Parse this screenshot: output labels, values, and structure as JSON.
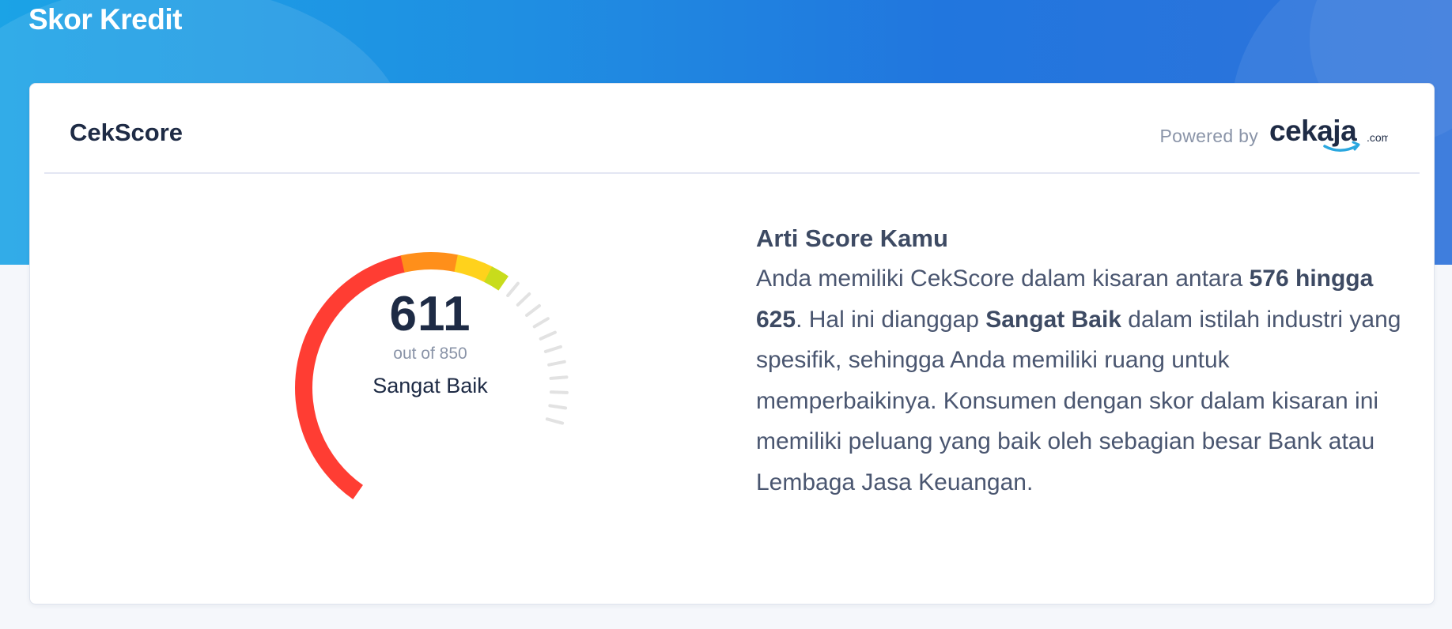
{
  "page": {
    "title": "Skor Kredit"
  },
  "card": {
    "title": "CekScore",
    "powered_by_label": "Powered by",
    "brand_logo": {
      "main": "cekaja",
      "suffix": ".com"
    }
  },
  "score": {
    "value": "611",
    "out_of": "out of 850",
    "rating": "Sangat Baik",
    "numeric_value": 611,
    "max": 850
  },
  "gauge": {
    "segment_colors": [
      "#ff3d33",
      "#ff8f1a",
      "#ffd21c",
      "#c8dc1c"
    ],
    "tick_color": "#e2e2e2"
  },
  "explanation": {
    "title": "Arti Score Kamu",
    "text_1": "Anda memiliki CekScore dalam kisaran antara ",
    "range": "576 hingga 625",
    "text_2": ". Hal ini dianggap ",
    "rating": "Sangat Baik",
    "text_3": " dalam istilah industri yang spesifik, sehingga Anda memiliki ruang untuk memperbaikinya. Konsumen dengan skor dalam kisaran ini memiliki peluang yang baik oleh sebagian besar Bank atau Lembaga Jasa Keuangan."
  },
  "colors": {
    "header_gradient_start": "#1ba3e6",
    "header_gradient_end": "#2f73db",
    "text_dark": "#1e2b45",
    "text_muted": "#8a94a8",
    "brand_dark": "#1e2b45",
    "brand_blue": "#2aa7df"
  }
}
